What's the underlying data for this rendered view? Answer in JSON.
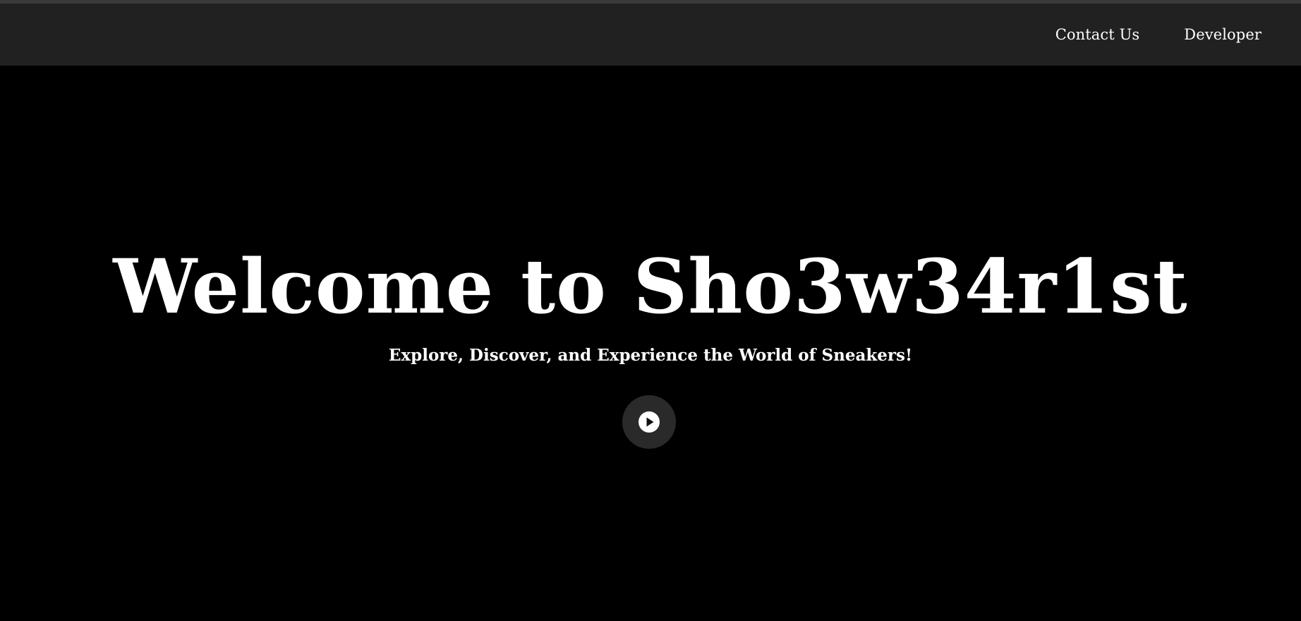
{
  "nav": {
    "links": [
      {
        "label": "Contact Us"
      },
      {
        "label": "Developer"
      }
    ]
  },
  "hero": {
    "title": "Welcome to Sho3w34r1st",
    "subtitle": "Explore, Discover, and Experience the World of Sneakers!",
    "play_icon": "play-circle-icon"
  },
  "colors": {
    "background": "#000000",
    "navbar": "#212121",
    "top_strip": "#3a3a3a",
    "text": "#ffffff",
    "play_button_bg": "#2a2a2a"
  }
}
